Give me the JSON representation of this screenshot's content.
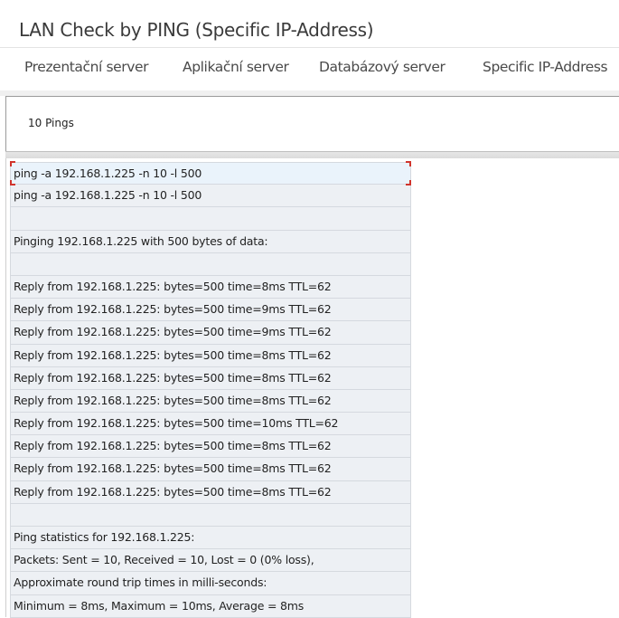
{
  "window": {
    "title": "LAN Check by PING (Specific IP-Address)"
  },
  "tabs": [
    {
      "label": "Prezentační server"
    },
    {
      "label": "Aplikační server"
    },
    {
      "label": "Databázový server"
    },
    {
      "label": "Specific IP-Address"
    }
  ],
  "toolbar": {
    "pings_label": "10 Pings"
  },
  "output": {
    "lines": [
      "ping -a 192.168.1.225  -n 10 -l 500",
      "ping -a 192.168.1.225  -n 10 -l 500",
      "",
      "Pinging 192.168.1.225 with 500 bytes of data:",
      "",
      "Reply from 192.168.1.225: bytes=500 time=8ms TTL=62",
      "Reply from 192.168.1.225: bytes=500 time=9ms TTL=62",
      "Reply from 192.168.1.225: bytes=500 time=9ms TTL=62",
      "Reply from 192.168.1.225: bytes=500 time=8ms TTL=62",
      "Reply from 192.168.1.225: bytes=500 time=8ms TTL=62",
      "Reply from 192.168.1.225: bytes=500 time=8ms TTL=62",
      "Reply from 192.168.1.225: bytes=500 time=10ms TTL=62",
      "Reply from 192.168.1.225: bytes=500 time=8ms TTL=62",
      "Reply from 192.168.1.225: bytes=500 time=8ms TTL=62",
      "Reply from 192.168.1.225: bytes=500 time=8ms TTL=62",
      "",
      "Ping statistics for 192.168.1.225:",
      "Packets: Sent = 10, Received = 10, Lost = 0 (0% loss),",
      "Approximate round trip times in milli-seconds:",
      "Minimum = 8ms, Maximum = 10ms, Average = 8ms"
    ]
  },
  "colors": {
    "selection_marker": "#d0342c",
    "row_background": "#edf0f4"
  }
}
